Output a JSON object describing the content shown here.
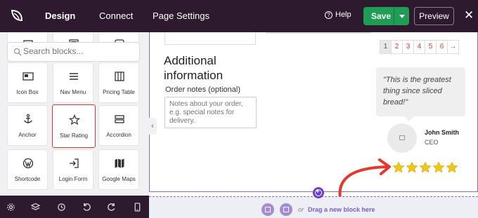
{
  "topbar": {
    "tabs": [
      {
        "label": "Design",
        "active": true
      },
      {
        "label": "Connect",
        "active": false
      },
      {
        "label": "Page Settings",
        "active": false
      }
    ],
    "help_label": "Help",
    "save_label": "Save",
    "preview_label": "Preview"
  },
  "sidebar": {
    "search_placeholder": "Search blocks...",
    "blocks": [
      {
        "label": "Icon Box",
        "icon": "icon-box-icon"
      },
      {
        "label": "Nav Menu",
        "icon": "nav-menu-icon"
      },
      {
        "label": "Pricing Table",
        "icon": "pricing-table-icon"
      },
      {
        "label": "Anchor",
        "icon": "anchor-icon"
      },
      {
        "label": "Star Rating",
        "icon": "star-icon",
        "highlighted": true
      },
      {
        "label": "Accordion",
        "icon": "accordion-icon"
      },
      {
        "label": "Shortcode",
        "icon": "wordpress-icon"
      },
      {
        "label": "Login Form",
        "icon": "login-icon"
      },
      {
        "label": "Google Maps",
        "icon": "map-icon"
      }
    ]
  },
  "canvas": {
    "heading": "Additional information",
    "order_label": "Order notes (optional)",
    "order_placeholder": "Notes about your order, e.g. special notes for delivery.",
    "pagination": [
      "1",
      "2",
      "3",
      "4",
      "5",
      "6",
      "→"
    ],
    "testimonial": {
      "quote": "\"This is the greatest thing since sliced bread!\"",
      "name": "John Smith",
      "title": "CEO"
    },
    "rating": 5
  },
  "dropzone": {
    "or": "or",
    "drag_label": "Drag a new block here"
  },
  "colors": {
    "topbar": "#2e1a2e",
    "save": "#1f9d55",
    "accent": "#7a5fc9",
    "star": "#f5c518",
    "highlight": "#e5382c"
  }
}
